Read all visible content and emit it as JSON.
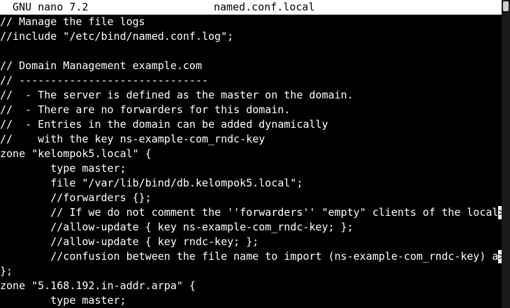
{
  "titlebar": {
    "app_name": "GNU nano 7.2",
    "file_name": "named.conf.local"
  },
  "editor": {
    "lines": [
      {
        "text": "// Manage the file logs",
        "overflow": ""
      },
      {
        "text": "//include \"/etc/bind/named.conf.log\";",
        "overflow": ""
      },
      {
        "text": "",
        "overflow": ""
      },
      {
        "text": "// Domain Management example.com",
        "overflow": ""
      },
      {
        "text": "// ------------------------------",
        "overflow": ""
      },
      {
        "text": "//  - The server is defined as the master on the domain.",
        "overflow": ""
      },
      {
        "text": "//  - There are no forwarders for this domain.",
        "overflow": ""
      },
      {
        "text": "//  - Entries in the domain can be added dynamically",
        "overflow": ""
      },
      {
        "text": "//    with the key ns-example-com_rndc-key",
        "overflow": ""
      },
      {
        "text": "zone \"kelompok5.local\" {",
        "overflow": ""
      },
      {
        "text": "        type master;",
        "overflow": ""
      },
      {
        "text": "        file \"/var/lib/bind/db.kelompok5.local\";",
        "overflow": ""
      },
      {
        "text": "        //forwarders {};",
        "overflow": ""
      },
      {
        "text": "        // If we do not comment the ''forwarders'' \"empty\" clients of the local",
        "overflow": ">"
      },
      {
        "text": "        //allow-update { key ns-example-com_rndc-key; };",
        "overflow": ""
      },
      {
        "text": "        //allow-update { key rndc-key; };",
        "overflow": ""
      },
      {
        "text": "        //confusion between the file name to import (ns-example-com_rndc-key) a",
        "overflow": ">"
      },
      {
        "text": "};",
        "overflow": ""
      },
      {
        "text": "zone \"5.168.192.in-addr.arpa\" {",
        "overflow": ""
      },
      {
        "text": "        type master;",
        "overflow": ""
      }
    ]
  },
  "colors": {
    "background": "#000000",
    "foreground": "#ffffff",
    "titlebar_background": "#ffffff",
    "titlebar_foreground": "#000000"
  }
}
